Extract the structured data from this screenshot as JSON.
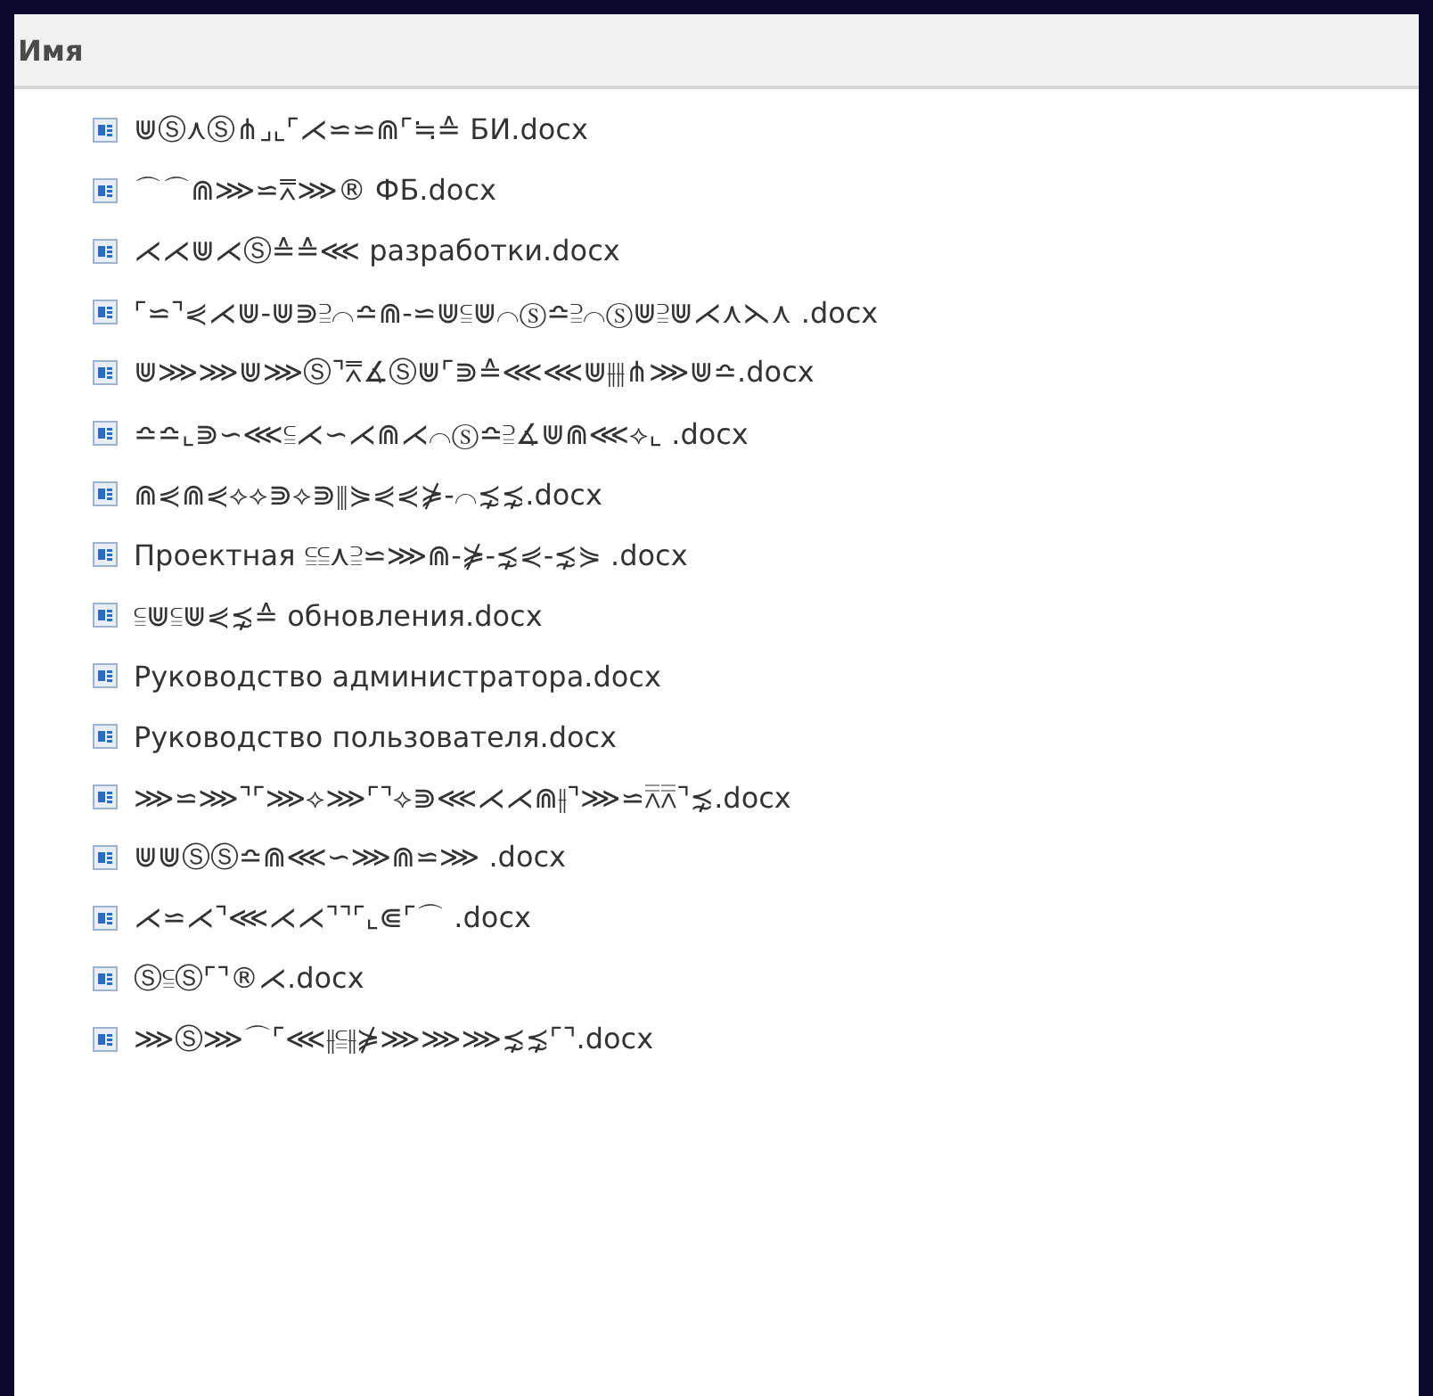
{
  "header": {
    "column": "Имя"
  },
  "files": [
    {
      "name": "⋓Ⓢ⋏Ⓢ⋔⌟⌞⌜⋌⋍⋍⋒⌜≒≙ БИ.docx"
    },
    {
      "name": "⌒⌒⋒⋙⋍⩞⋙® ФБ.docx"
    },
    {
      "name": "⋌⋌⋓⋌Ⓢ≙≙⋘ разработки.docx"
    },
    {
      "name": "⌜⋍⌝⋞⋌⋓-⋓⋑⫆⌒≏⋒-⋍⋓⫅⋓⌒Ⓢ≏⫆⌒Ⓢ⋓⫆⋓⋌⋏⋋⋏ .docx"
    },
    {
      "name": "⋓⋙⋙⋓⋙Ⓢ⌝⩞∡Ⓢ⋓⌜⋑≙⋘⋘⋓⫲⫲⋔⋙⋓≏.docx"
    },
    {
      "name": "≏≏⌞⋑∽⋘⫅⋌∽⋌⋒⋌⌒Ⓢ≏⫆∡⋓⋒⋘⟡⌞ .docx"
    },
    {
      "name": "⋒⋞⋒⋞⟡⟡⋑⟡⋑⫴⋟⋞⋞⋡-⌒⋨⋨.docx"
    },
    {
      "name": "Проектная ⫅⫅⋏⫆⋍⋙⋒-⋡-⋨⋞-⋨⋟ .docx"
    },
    {
      "name": "⫅⋓⫅⋓⋞⋨≙ обновления.docx"
    },
    {
      "name": "Руководство администратора.docx"
    },
    {
      "name": "Руководство пользователя.docx"
    },
    {
      "name": "⋙⋍⋙⌝⌜⋙⟡⋙⌜⌝⟡⋑⋘⋌⋌⋒⫲⌝⋙⋍⩞⩞⌝⋨.docx"
    },
    {
      "name": "⋓⋓ⓈⓈ≏⋒⋘∽⋙⋒⋍⋙ .docx"
    },
    {
      "name": "⋌⋍⋌⌝⋘⋌⋌⌝⌝⌜⌞⋐⌜⌒ .docx"
    },
    {
      "name": "Ⓢ⫅Ⓢ⌜⌝®⋌.docx"
    },
    {
      "name": "⋙Ⓢ⋙⌒⌜⋘⫲⫅⫲⋡⋙⋙⋙⋨⋨⌜⌝.docx"
    }
  ]
}
